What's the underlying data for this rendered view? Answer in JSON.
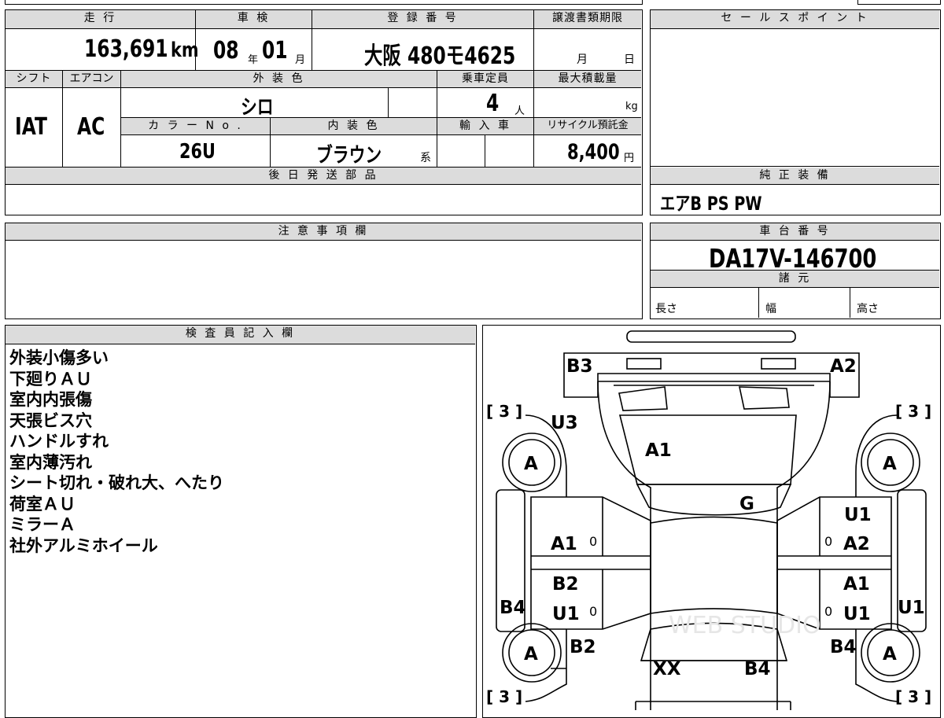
{
  "headers": {
    "mileage": "走 行",
    "inspection": "車 検",
    "registration": "登 録 番 号",
    "transfer_deadline": "譲渡書類期限",
    "sales_point": "セ ー ル ス ポ イ ン ト",
    "shift": "シフト",
    "aircon": "エアコン",
    "exterior_color": "外 装 色",
    "capacity": "乗車定員",
    "max_load": "最大積載量",
    "color_no": "カ ラ ー N o .",
    "interior_color": "内 装 色",
    "import_car": "輸 入 車",
    "recycle_fee": "リサイクル預託金",
    "later_parts": "後 日 発 送 部 品",
    "genuine_equipment": "純 正 装 備",
    "caution": "注 意 事 項 欄",
    "chassis_no": "車 台 番 号",
    "specs": "諸 元",
    "inspector_notes": "検 査 員 記 入 欄"
  },
  "values": {
    "mileage": "163,691",
    "mileage_unit": "km",
    "inspection_year": "08",
    "year_unit": "年",
    "inspection_month": "01",
    "month_unit": "月",
    "registration": "大阪 480モ4625",
    "deadline_month": "月",
    "deadline_day": "日",
    "shift": "IAT",
    "aircon": "AC",
    "exterior_color": "シロ",
    "capacity": "4",
    "capacity_unit": "人",
    "max_load_unit": "kg",
    "color_no": "26U",
    "interior_color": "ブラウン",
    "interior_suffix": "系",
    "recycle_fee": "8,400",
    "yen": "円",
    "genuine_equipment": "エアB PS PW",
    "chassis_no": "DA17V-146700",
    "length": "長さ",
    "width": "幅",
    "height": "高さ"
  },
  "notes": [
    "外装小傷多い",
    "下廻りＡＵ",
    "室内内張傷",
    "天張ビス穴",
    "ハンドルすれ",
    "室内薄汚れ",
    "シート切れ・破れ大、へたり",
    "荷室ＡＵ",
    "ミラーＡ",
    "社外アルミホイール"
  ],
  "diagram": {
    "b3_top": "B3",
    "a2_top": "A2",
    "bracket_tl": "[ 3 ]",
    "bracket_tr": "[ 3 ]",
    "bracket_bl": "[ 3 ]",
    "bracket_br": "[ 3 ]",
    "u3": "U3",
    "a1_hood": "A1",
    "g_glass": "G",
    "tire": "A",
    "u1_right": "U1",
    "a1_left": "A1",
    "a2_right": "A2",
    "zero": "0",
    "b2_left": "B2",
    "a1_right": "A1",
    "b4_left": "B4",
    "u1_left": "U1",
    "u1_right2": "U1",
    "u1_side": "U1",
    "b2_rear": "B2",
    "b4_rear": "B4",
    "xx": "XX"
  },
  "watermark": "WEB STUDIO"
}
